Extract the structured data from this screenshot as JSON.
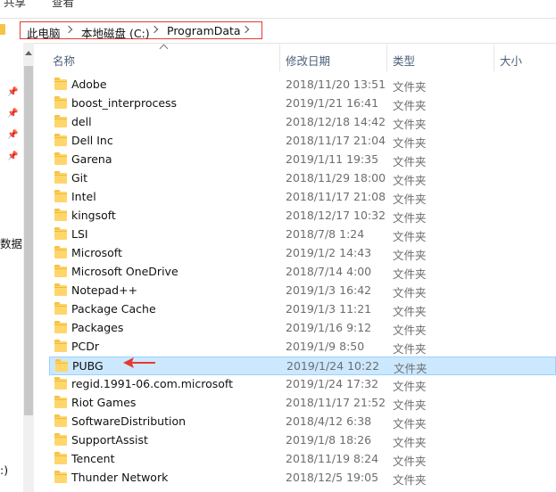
{
  "ribbon": {
    "share_tab": "共享",
    "view_tab": "查看"
  },
  "address": {
    "crumbs": [
      "此电脑",
      "本地磁盘 (C:)",
      "ProgramData"
    ]
  },
  "nav": {
    "clipped_label_1": "数据",
    "clipped_label_2": ":)"
  },
  "columns": {
    "name": "名称",
    "modified": "修改日期",
    "type": "类型",
    "size": "大小"
  },
  "files": [
    {
      "name": "Adobe",
      "date": "2018/11/20 13:51",
      "type": "文件夹"
    },
    {
      "name": "boost_interprocess",
      "date": "2019/1/21 16:41",
      "type": "文件夹"
    },
    {
      "name": "dell",
      "date": "2018/12/18 14:42",
      "type": "文件夹"
    },
    {
      "name": "Dell Inc",
      "date": "2018/11/17 21:04",
      "type": "文件夹"
    },
    {
      "name": "Garena",
      "date": "2019/1/11 19:35",
      "type": "文件夹"
    },
    {
      "name": "Git",
      "date": "2018/11/29 18:00",
      "type": "文件夹"
    },
    {
      "name": "Intel",
      "date": "2018/11/17 21:08",
      "type": "文件夹"
    },
    {
      "name": "kingsoft",
      "date": "2018/12/17 10:32",
      "type": "文件夹"
    },
    {
      "name": "LSI",
      "date": "2018/7/8 1:24",
      "type": "文件夹"
    },
    {
      "name": "Microsoft",
      "date": "2019/1/2 14:43",
      "type": "文件夹"
    },
    {
      "name": "Microsoft OneDrive",
      "date": "2018/7/14 4:00",
      "type": "文件夹"
    },
    {
      "name": "Notepad++",
      "date": "2019/1/3 16:42",
      "type": "文件夹"
    },
    {
      "name": "Package Cache",
      "date": "2019/1/3 11:21",
      "type": "文件夹"
    },
    {
      "name": "Packages",
      "date": "2019/1/16 9:12",
      "type": "文件夹"
    },
    {
      "name": "PCDr",
      "date": "2019/1/9 8:50",
      "type": "文件夹"
    },
    {
      "name": "PUBG",
      "date": "2019/1/24 10:22",
      "type": "文件夹",
      "selected": true
    },
    {
      "name": "regid.1991-06.com.microsoft",
      "date": "2019/1/24 17:32",
      "type": "文件夹"
    },
    {
      "name": "Riot Games",
      "date": "2018/11/17 21:52",
      "type": "文件夹"
    },
    {
      "name": "SoftwareDistribution",
      "date": "2018/4/12 6:38",
      "type": "文件夹"
    },
    {
      "name": "SupportAssist",
      "date": "2019/1/8 18:26",
      "type": "文件夹"
    },
    {
      "name": "Tencent",
      "date": "2018/11/19 8:24",
      "type": "文件夹"
    },
    {
      "name": "Thunder Network",
      "date": "2018/12/5 19:05",
      "type": "文件夹"
    }
  ],
  "colors": {
    "highlight_border": "#e53935",
    "selection_bg": "#cce8ff",
    "selection_border": "#99d1ff",
    "folder": "#ffd66b",
    "arrow": "#e53935"
  }
}
